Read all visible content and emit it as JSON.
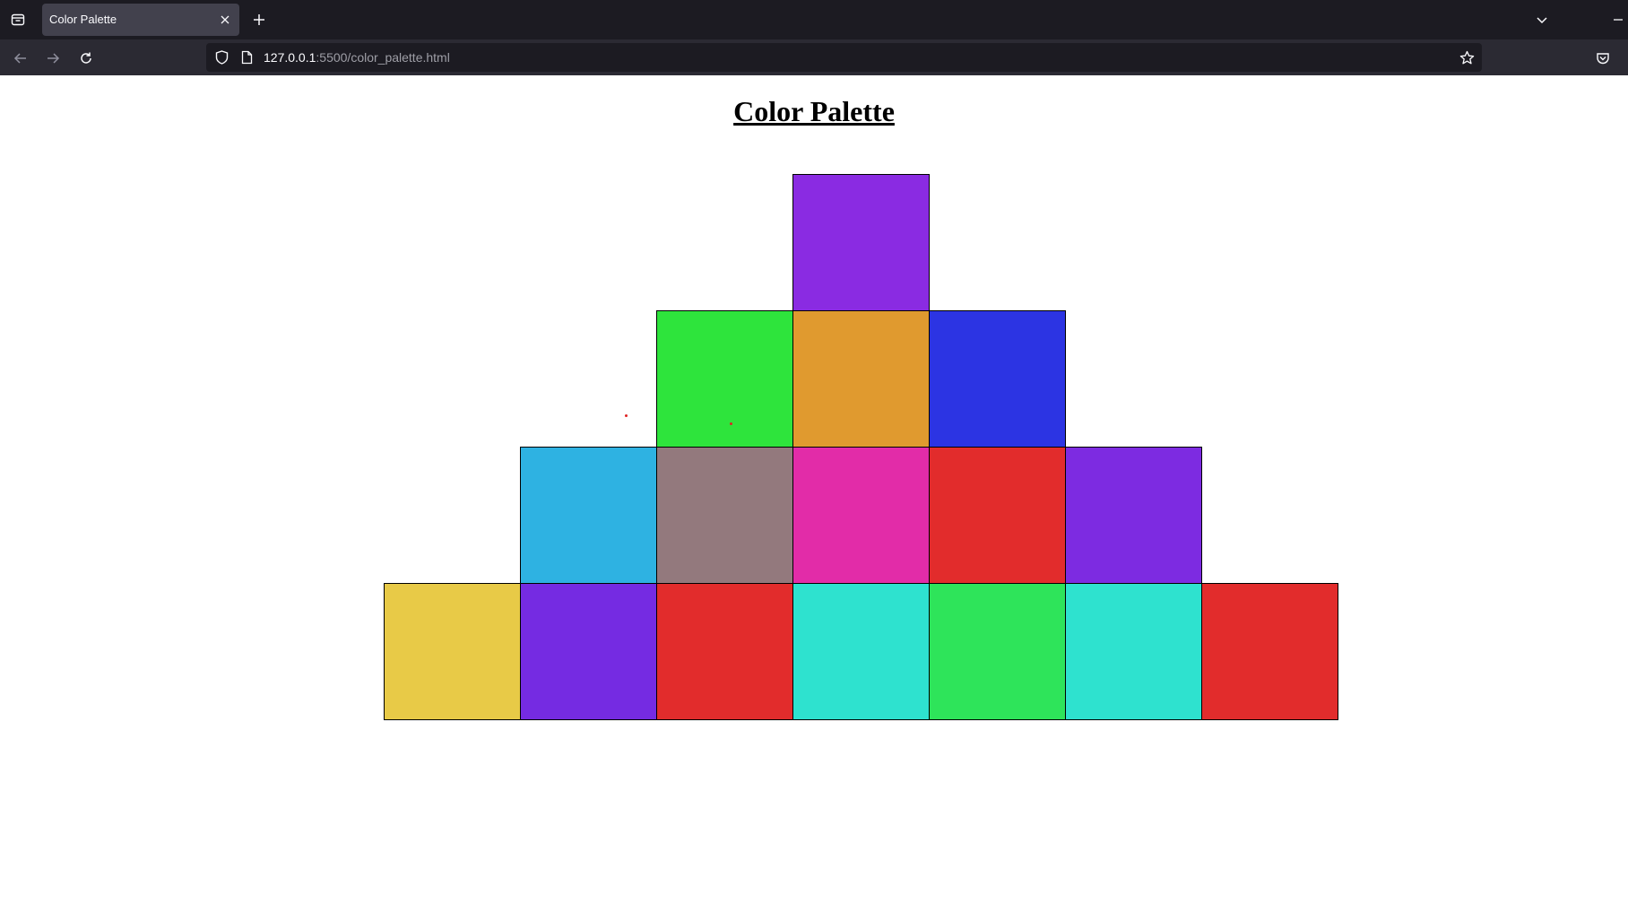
{
  "browser": {
    "tab_title": "Color Palette",
    "url_host": "127.0.0.1",
    "url_path": ":5500/color_palette.html"
  },
  "page": {
    "title": "Color Palette"
  },
  "palette": {
    "rows": [
      [
        "#8a2be2"
      ],
      [
        "#2ee43c",
        "#e09a2f",
        "#2c34e3"
      ],
      [
        "#2eb2e2",
        "#93797d",
        "#e22ca8",
        "#e22c2c",
        "#7d2be1"
      ],
      [
        "#e8ca47",
        "#752be2",
        "#e22c2c",
        "#2ee2cf",
        "#2ee45a",
        "#2ee2cf",
        "#e22c2c"
      ]
    ]
  },
  "colors": {
    "chrome_bg": "#1c1b22",
    "toolbar_bg": "#2b2a33",
    "tab_active_bg": "#42414d",
    "dot": "#e02424"
  }
}
